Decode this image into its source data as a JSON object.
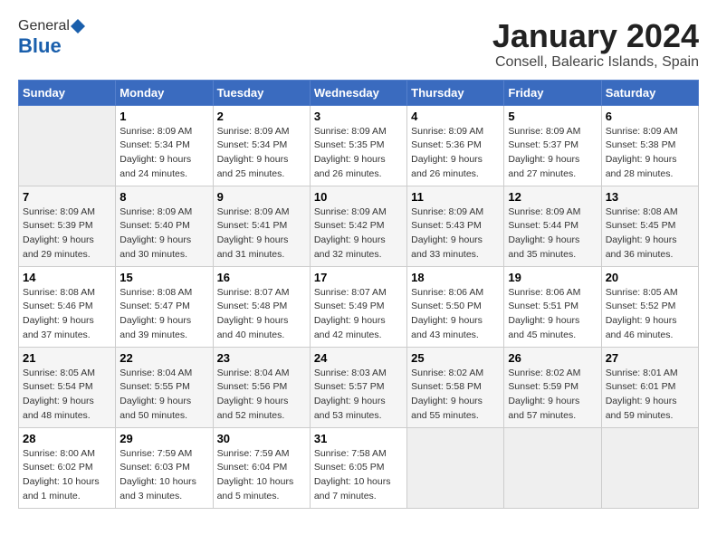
{
  "logo": {
    "general": "General",
    "blue": "Blue"
  },
  "title": "January 2024",
  "location": "Consell, Balearic Islands, Spain",
  "days_of_week": [
    "Sunday",
    "Monday",
    "Tuesday",
    "Wednesday",
    "Thursday",
    "Friday",
    "Saturday"
  ],
  "weeks": [
    [
      {
        "day": "",
        "sunrise": "",
        "sunset": "",
        "daylight": ""
      },
      {
        "day": "1",
        "sunrise": "Sunrise: 8:09 AM",
        "sunset": "Sunset: 5:34 PM",
        "daylight": "Daylight: 9 hours and 24 minutes."
      },
      {
        "day": "2",
        "sunrise": "Sunrise: 8:09 AM",
        "sunset": "Sunset: 5:34 PM",
        "daylight": "Daylight: 9 hours and 25 minutes."
      },
      {
        "day": "3",
        "sunrise": "Sunrise: 8:09 AM",
        "sunset": "Sunset: 5:35 PM",
        "daylight": "Daylight: 9 hours and 26 minutes."
      },
      {
        "day": "4",
        "sunrise": "Sunrise: 8:09 AM",
        "sunset": "Sunset: 5:36 PM",
        "daylight": "Daylight: 9 hours and 26 minutes."
      },
      {
        "day": "5",
        "sunrise": "Sunrise: 8:09 AM",
        "sunset": "Sunset: 5:37 PM",
        "daylight": "Daylight: 9 hours and 27 minutes."
      },
      {
        "day": "6",
        "sunrise": "Sunrise: 8:09 AM",
        "sunset": "Sunset: 5:38 PM",
        "daylight": "Daylight: 9 hours and 28 minutes."
      }
    ],
    [
      {
        "day": "7",
        "sunrise": "Sunrise: 8:09 AM",
        "sunset": "Sunset: 5:39 PM",
        "daylight": "Daylight: 9 hours and 29 minutes."
      },
      {
        "day": "8",
        "sunrise": "Sunrise: 8:09 AM",
        "sunset": "Sunset: 5:40 PM",
        "daylight": "Daylight: 9 hours and 30 minutes."
      },
      {
        "day": "9",
        "sunrise": "Sunrise: 8:09 AM",
        "sunset": "Sunset: 5:41 PM",
        "daylight": "Daylight: 9 hours and 31 minutes."
      },
      {
        "day": "10",
        "sunrise": "Sunrise: 8:09 AM",
        "sunset": "Sunset: 5:42 PM",
        "daylight": "Daylight: 9 hours and 32 minutes."
      },
      {
        "day": "11",
        "sunrise": "Sunrise: 8:09 AM",
        "sunset": "Sunset: 5:43 PM",
        "daylight": "Daylight: 9 hours and 33 minutes."
      },
      {
        "day": "12",
        "sunrise": "Sunrise: 8:09 AM",
        "sunset": "Sunset: 5:44 PM",
        "daylight": "Daylight: 9 hours and 35 minutes."
      },
      {
        "day": "13",
        "sunrise": "Sunrise: 8:08 AM",
        "sunset": "Sunset: 5:45 PM",
        "daylight": "Daylight: 9 hours and 36 minutes."
      }
    ],
    [
      {
        "day": "14",
        "sunrise": "Sunrise: 8:08 AM",
        "sunset": "Sunset: 5:46 PM",
        "daylight": "Daylight: 9 hours and 37 minutes."
      },
      {
        "day": "15",
        "sunrise": "Sunrise: 8:08 AM",
        "sunset": "Sunset: 5:47 PM",
        "daylight": "Daylight: 9 hours and 39 minutes."
      },
      {
        "day": "16",
        "sunrise": "Sunrise: 8:07 AM",
        "sunset": "Sunset: 5:48 PM",
        "daylight": "Daylight: 9 hours and 40 minutes."
      },
      {
        "day": "17",
        "sunrise": "Sunrise: 8:07 AM",
        "sunset": "Sunset: 5:49 PM",
        "daylight": "Daylight: 9 hours and 42 minutes."
      },
      {
        "day": "18",
        "sunrise": "Sunrise: 8:06 AM",
        "sunset": "Sunset: 5:50 PM",
        "daylight": "Daylight: 9 hours and 43 minutes."
      },
      {
        "day": "19",
        "sunrise": "Sunrise: 8:06 AM",
        "sunset": "Sunset: 5:51 PM",
        "daylight": "Daylight: 9 hours and 45 minutes."
      },
      {
        "day": "20",
        "sunrise": "Sunrise: 8:05 AM",
        "sunset": "Sunset: 5:52 PM",
        "daylight": "Daylight: 9 hours and 46 minutes."
      }
    ],
    [
      {
        "day": "21",
        "sunrise": "Sunrise: 8:05 AM",
        "sunset": "Sunset: 5:54 PM",
        "daylight": "Daylight: 9 hours and 48 minutes."
      },
      {
        "day": "22",
        "sunrise": "Sunrise: 8:04 AM",
        "sunset": "Sunset: 5:55 PM",
        "daylight": "Daylight: 9 hours and 50 minutes."
      },
      {
        "day": "23",
        "sunrise": "Sunrise: 8:04 AM",
        "sunset": "Sunset: 5:56 PM",
        "daylight": "Daylight: 9 hours and 52 minutes."
      },
      {
        "day": "24",
        "sunrise": "Sunrise: 8:03 AM",
        "sunset": "Sunset: 5:57 PM",
        "daylight": "Daylight: 9 hours and 53 minutes."
      },
      {
        "day": "25",
        "sunrise": "Sunrise: 8:02 AM",
        "sunset": "Sunset: 5:58 PM",
        "daylight": "Daylight: 9 hours and 55 minutes."
      },
      {
        "day": "26",
        "sunrise": "Sunrise: 8:02 AM",
        "sunset": "Sunset: 5:59 PM",
        "daylight": "Daylight: 9 hours and 57 minutes."
      },
      {
        "day": "27",
        "sunrise": "Sunrise: 8:01 AM",
        "sunset": "Sunset: 6:01 PM",
        "daylight": "Daylight: 9 hours and 59 minutes."
      }
    ],
    [
      {
        "day": "28",
        "sunrise": "Sunrise: 8:00 AM",
        "sunset": "Sunset: 6:02 PM",
        "daylight": "Daylight: 10 hours and 1 minute."
      },
      {
        "day": "29",
        "sunrise": "Sunrise: 7:59 AM",
        "sunset": "Sunset: 6:03 PM",
        "daylight": "Daylight: 10 hours and 3 minutes."
      },
      {
        "day": "30",
        "sunrise": "Sunrise: 7:59 AM",
        "sunset": "Sunset: 6:04 PM",
        "daylight": "Daylight: 10 hours and 5 minutes."
      },
      {
        "day": "31",
        "sunrise": "Sunrise: 7:58 AM",
        "sunset": "Sunset: 6:05 PM",
        "daylight": "Daylight: 10 hours and 7 minutes."
      },
      {
        "day": "",
        "sunrise": "",
        "sunset": "",
        "daylight": ""
      },
      {
        "day": "",
        "sunrise": "",
        "sunset": "",
        "daylight": ""
      },
      {
        "day": "",
        "sunrise": "",
        "sunset": "",
        "daylight": ""
      }
    ]
  ]
}
